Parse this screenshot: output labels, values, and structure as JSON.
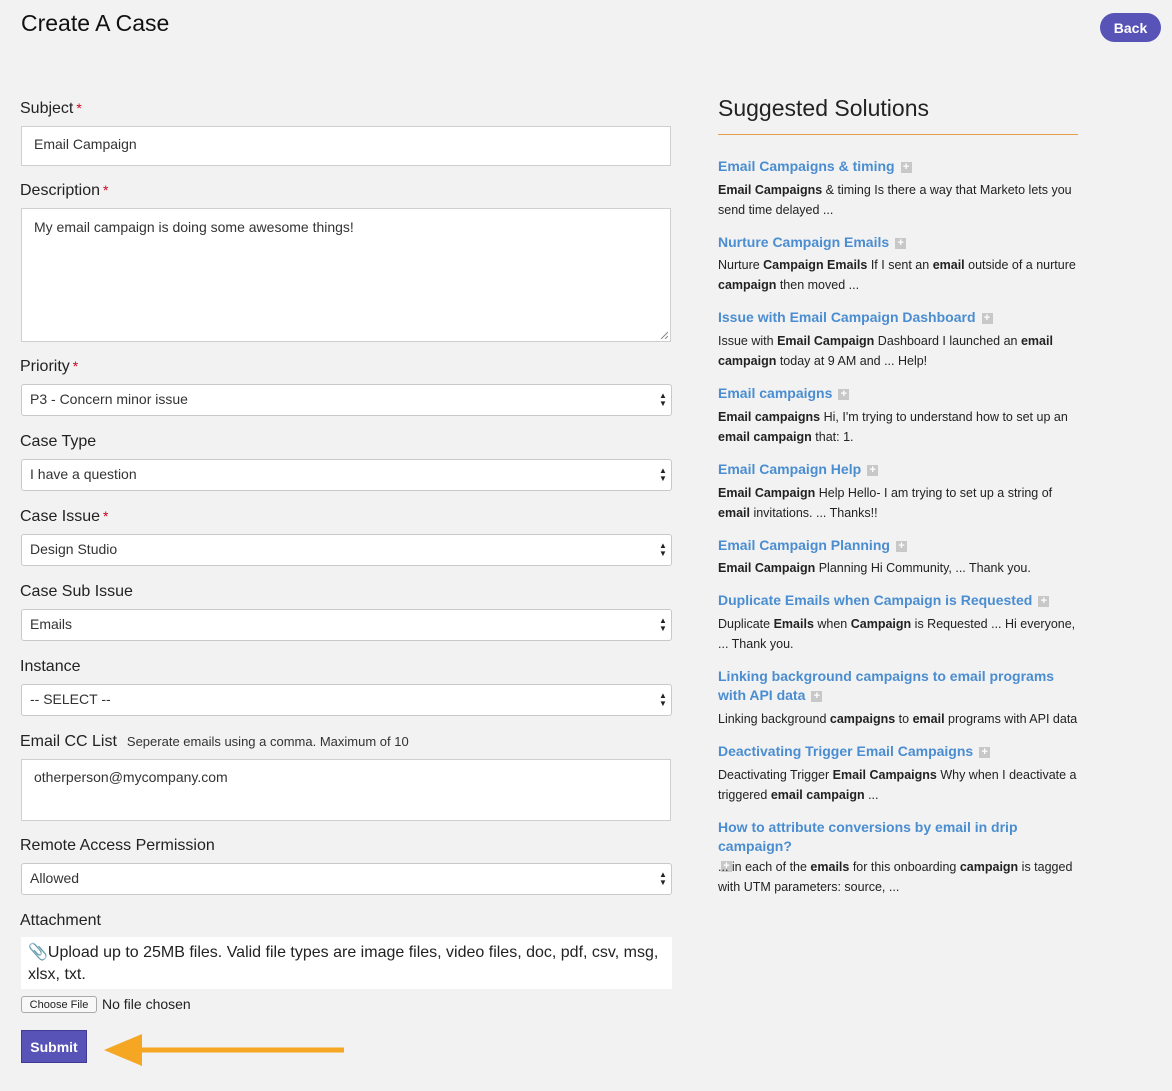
{
  "page": {
    "title": "Create A Case",
    "back_label": "Back"
  },
  "form": {
    "subject": {
      "label": "Subject",
      "value": "Email Campaign"
    },
    "description": {
      "label": "Description",
      "value": "My email campaign is doing some awesome things!"
    },
    "priority": {
      "label": "Priority",
      "value": "P3 - Concern minor issue"
    },
    "case_type": {
      "label": "Case Type",
      "value": "I have a question"
    },
    "case_issue": {
      "label": "Case Issue",
      "value": "Design Studio"
    },
    "case_sub_issue": {
      "label": "Case Sub Issue",
      "value": "Emails"
    },
    "instance": {
      "label": "Instance",
      "value": "-- SELECT --"
    },
    "email_cc": {
      "label": "Email CC List",
      "hint": "Seperate emails using a comma. Maximum of 10",
      "value": "otherperson@mycompany.com"
    },
    "remote_access": {
      "label": "Remote Access Permission",
      "value": "Allowed"
    },
    "attachment": {
      "label": "Attachment",
      "note": "Upload up to 25MB files. Valid file types are image files, video files, doc, pdf, csv, msg, xlsx, txt.",
      "choose_label": "Choose File",
      "no_file": "No file chosen"
    },
    "submit_label": "Submit"
  },
  "suggestions": {
    "title": "Suggested Solutions",
    "items": [
      {
        "title": "Email Campaigns & timing",
        "snippet": [
          [
            "Email Campaigns",
            true
          ],
          [
            " & timing Is there a way that Marketo lets you send time delayed ...",
            false
          ]
        ]
      },
      {
        "title": "Nurture Campaign Emails",
        "snippet": [
          [
            "Nurture ",
            false
          ],
          [
            "Campaign Emails",
            true
          ],
          [
            " If I sent an ",
            false
          ],
          [
            "email",
            true
          ],
          [
            " outside of a nurture ",
            false
          ],
          [
            "campaign",
            true
          ],
          [
            " then moved ...",
            false
          ]
        ]
      },
      {
        "title": "Issue with Email Campaign Dashboard",
        "snippet": [
          [
            "Issue with ",
            false
          ],
          [
            "Email Campaign",
            true
          ],
          [
            " Dashboard I launched an ",
            false
          ],
          [
            "email campaign",
            true
          ],
          [
            " today at 9 AM and ... Help!",
            false
          ]
        ]
      },
      {
        "title": "Email campaigns",
        "snippet": [
          [
            "Email campaigns",
            true
          ],
          [
            " Hi, I'm trying to understand how to set up an ",
            false
          ],
          [
            "email campaign",
            true
          ],
          [
            " that: 1.",
            false
          ]
        ]
      },
      {
        "title": "Email Campaign Help",
        "snippet": [
          [
            "Email Campaign",
            true
          ],
          [
            " Help Hello- I am trying to set up a string of ",
            false
          ],
          [
            "email",
            true
          ],
          [
            " invitations. ... Thanks!!",
            false
          ]
        ]
      },
      {
        "title": "Email Campaign Planning",
        "snippet": [
          [
            "Email Campaign",
            true
          ],
          [
            " Planning Hi Community, ... Thank you.",
            false
          ]
        ]
      },
      {
        "title": "Duplicate Emails when Campaign is Requested",
        "snippet": [
          [
            "Duplicate ",
            false
          ],
          [
            "Emails",
            true
          ],
          [
            " when ",
            false
          ],
          [
            "Campaign",
            true
          ],
          [
            " is Requested ... Hi everyone, ... Thank you.",
            false
          ]
        ]
      },
      {
        "title": "Linking background campaigns to email programs with API data",
        "snippet": [
          [
            "Linking background ",
            false
          ],
          [
            "campaigns",
            true
          ],
          [
            " to ",
            false
          ],
          [
            "email",
            true
          ],
          [
            " programs with API data",
            false
          ]
        ]
      },
      {
        "title": "Deactivating Trigger Email Campaigns",
        "snippet": [
          [
            "Deactivating Trigger ",
            false
          ],
          [
            "Email Campaigns",
            true
          ],
          [
            " Why when I deactivate a triggered ",
            false
          ],
          [
            "email campaign",
            true
          ],
          [
            " ...",
            false
          ]
        ]
      },
      {
        "title": "How to attribute conversions by email in drip campaign?",
        "snippet": [
          [
            "... in each of the ",
            false
          ],
          [
            "emails",
            true
          ],
          [
            " for this onboarding ",
            false
          ],
          [
            "campaign",
            true
          ],
          [
            " is tagged with UTM parameters: source, ...",
            false
          ]
        ]
      }
    ]
  },
  "colors": {
    "accent": "#5753b7",
    "link": "#4a8dd1",
    "required": "#d0021b",
    "rule": "#e2a04d",
    "arrow": "#f5a623"
  }
}
